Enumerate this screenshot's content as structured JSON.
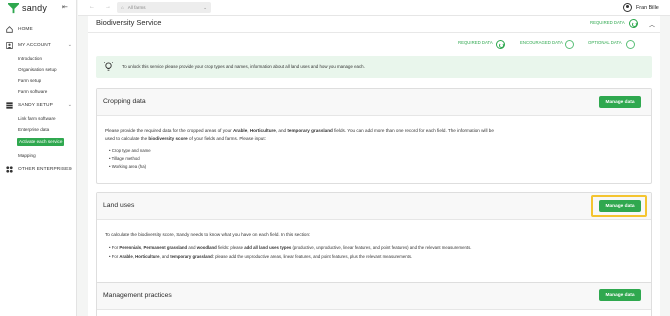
{
  "app": {
    "logo_text": "sandy"
  },
  "sidebar": {
    "home": "HOME",
    "my_account": {
      "label": "MY ACCOUNT",
      "items": [
        "Introduction",
        "Organisation setup",
        "Farm setup",
        "Farm software"
      ]
    },
    "sandy_setup": {
      "label": "SANDY SETUP",
      "items": [
        "Link farm software",
        "Enterprise data",
        "Activate each service",
        "Mapping"
      ],
      "active_index": 2
    },
    "other_enterprises": "OTHER ENTERPRISES"
  },
  "topbar": {
    "farm_select_value": "All farms",
    "user_name": "Fran Bille"
  },
  "service": {
    "title": "Biodiversity Service",
    "status_label": "REQUIRED DATA",
    "legend": {
      "required": "REQUIRED DATA",
      "encouraged": "ENCOURAGED DATA",
      "optional": "OPTIONAL DATA"
    },
    "info_text": "To unlock this service please provide your crop types and names, information about all land uses and how you manage each."
  },
  "cards": {
    "cropping": {
      "title": "Cropping data",
      "button": "Manage data",
      "p1": "Please provide the required data for the cropped areas of your ",
      "p1_b1": "Arable",
      "p1_c1": ", ",
      "p1_b2": "Horticulture",
      "p1_c2": ", and ",
      "p1_b3": "temporary grassland",
      "p1_c3": " fields. You can add more than one record for each field. The information will be",
      "p2": "used to calculate the ",
      "p2_b": "biodiversity score",
      "p2_c": " of your fields and farms. Please input:",
      "bullets": [
        "Crop type and name",
        "Tillage method",
        "Working area (ha)"
      ]
    },
    "land_uses": {
      "title": "Land uses",
      "button": "Manage data",
      "p1": "To calculate the biodiversity score, Sandy needs to know what you have on each field. In this section:",
      "b1_pre": "For ",
      "b1_s1": "Perennials",
      "b1_c1": ", ",
      "b1_s2": "Permanent grassland",
      "b1_c2": " and ",
      "b1_s3": "woodland",
      "b1_c3": " fields: please ",
      "b1_s4": "add all land uses types",
      "b1_c4": " (productive, unproductive, linear features, and point features) and the relevant measurements.",
      "b2_pre": "For ",
      "b2_s1": "Arable",
      "b2_c1": ", ",
      "b2_s2": "Horticulture",
      "b2_c2": ", and ",
      "b2_s3": "temporary grassland",
      "b2_c3": ": please add the unproductive areas, linear features, and point features, plus the relevant measurements."
    },
    "management": {
      "title": "Management practices",
      "button": "Manage data"
    }
  },
  "colors": {
    "accent": "#2fa84f",
    "highlight": "#f4c430",
    "info_bg": "#e9f6ec"
  }
}
